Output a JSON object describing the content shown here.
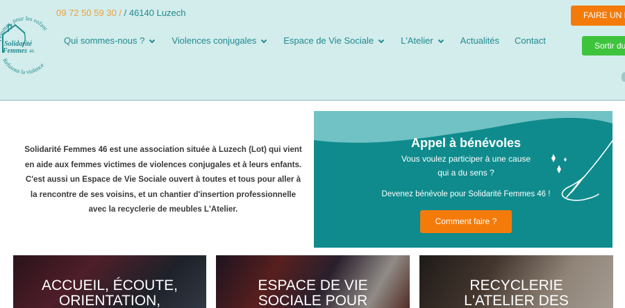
{
  "header": {
    "logo": {
      "arc_top": "Femmes, pour les enfants,",
      "name_line1": "Solidarité",
      "name_line2": "Femmes",
      "name_num": "46",
      "arc_bottom": "Refusons la violence"
    },
    "phone": "09 72 50 59 30 /",
    "location": "/ 46140 Luzech",
    "nav": [
      {
        "label": "Qui sommes-nous ?",
        "dropdown": true
      },
      {
        "label": "Violences conjugales",
        "dropdown": true
      },
      {
        "label": "Espace de Vie Sociale",
        "dropdown": true
      },
      {
        "label": "L'Atelier",
        "dropdown": true
      },
      {
        "label": "Actualités",
        "dropdown": false
      },
      {
        "label": "Contact",
        "dropdown": false
      }
    ],
    "donate_label": "FAIRE UN D",
    "exit_label": "Sortir du"
  },
  "intro": {
    "lines": [
      "Solidarité Femmes 46 est une association située à Luzech (Lot) qui vient",
      "en aide aux femmes victimes de violences conjugales et à leurs enfants.",
      "C'est aussi un Espace de Vie Sociale ouvert à toutes et tous pour aller à",
      "la rencontre de ses voisins, et un chantier d'insertion professionnelle",
      "avec la recyclerie de meubles L'Atelier."
    ]
  },
  "volunteer": {
    "title": "Appel à bénévoles",
    "line1": "Vous voulez participer à une cause",
    "line2": "qui a du sens ?",
    "line3": "Devenez bénévole pour Solidarité Femmes 46 !",
    "button": "Comment faire ?"
  },
  "cards": [
    {
      "title_lines": [
        "ACCUEIL, ÉCOUTE,",
        "ORIENTATION,"
      ]
    },
    {
      "title_lines": [
        "ESPACE DE VIE",
        "SOCIALE POUR"
      ]
    },
    {
      "title_lines": [
        "RECYCLERIE",
        "L'ATELIER DES"
      ]
    }
  ],
  "colors": {
    "header_bg": "#d3ecec",
    "teal": "#1f8b8f",
    "orange": "#f47b0a",
    "green": "#3ec43c",
    "phone": "#e8a33d"
  }
}
